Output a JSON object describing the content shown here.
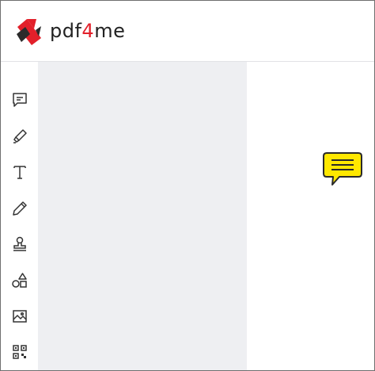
{
  "app": {
    "logo_text_prefix": "pdf",
    "logo_text_accent": "4",
    "logo_text_suffix": "me",
    "brand_color": "#e2202a"
  },
  "toolbar": {
    "items": [
      {
        "name": "comment",
        "icon": "comment-icon"
      },
      {
        "name": "highlight",
        "icon": "highlighter-icon"
      },
      {
        "name": "text",
        "icon": "text-icon"
      },
      {
        "name": "draw",
        "icon": "pencil-icon"
      },
      {
        "name": "stamp",
        "icon": "stamp-icon"
      },
      {
        "name": "shapes",
        "icon": "shapes-icon"
      },
      {
        "name": "image",
        "icon": "image-icon"
      },
      {
        "name": "qr-code",
        "icon": "qr-code-icon"
      }
    ]
  },
  "annotation": {
    "type": "note",
    "color": "#ffe800"
  }
}
